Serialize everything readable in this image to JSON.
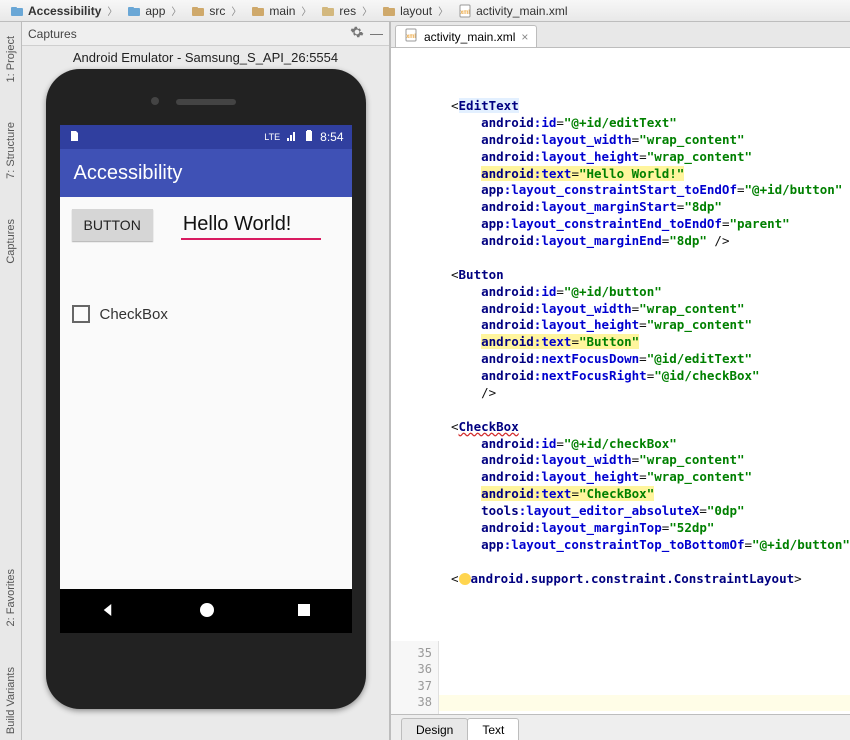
{
  "breadcrumbs": [
    "Accessibility",
    "app",
    "src",
    "main",
    "res",
    "layout",
    "activity_main.xml"
  ],
  "captures": {
    "title": "Captures",
    "emulator_title": "Android Emulator - Samsung_S_API_26:5554"
  },
  "side_tabs": {
    "project": "1: Project",
    "structure": "7: Structure",
    "captures": "Captures",
    "favorites": "2: Favorites",
    "build_variants": "Build Variants"
  },
  "phone": {
    "status_time": "8:54",
    "status_lte": "LTE",
    "app_title": "Accessibility",
    "button_label": "BUTTON",
    "edit_text": "Hello World!",
    "checkbox_label": "CheckBox"
  },
  "editor": {
    "tab_label": "activity_main.xml",
    "bottom_tabs": {
      "design": "Design",
      "text": "Text"
    },
    "gutter_lines": [
      "35",
      "36",
      "37",
      "38"
    ],
    "code": {
      "et_tag": "EditText",
      "et_id": "\"@+id/editText\"",
      "wrap": "\"wrap_content\"",
      "hello": "\"Hello World!\"",
      "start_to": "\"@+id/button\"",
      "m8": "\"8dp\"",
      "parent": "\"parent\"",
      "btn_tag": "Button",
      "btn_id": "\"@+id/button\"",
      "btn_text": "\"Button\"",
      "nfd": "\"@id/editText\"",
      "nfr": "\"@id/checkBox\"",
      "cb_tag": "CheckBox",
      "cb_id": "\"@+id/checkBox\"",
      "cb_text": "\"CheckBox\"",
      "absx": "\"0dp\"",
      "mtop": "\"52dp\"",
      "topto": "\"@+id/button\"",
      "close": "android.support.constraint.ConstraintLayout"
    }
  }
}
